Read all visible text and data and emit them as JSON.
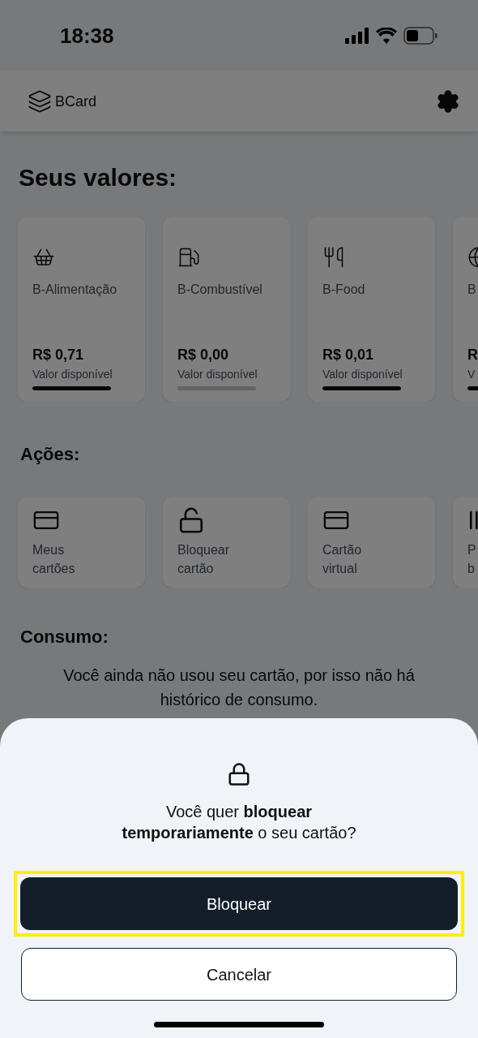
{
  "status_bar": {
    "time": "18:38"
  },
  "header": {
    "logo": "BCard"
  },
  "balances": {
    "title": "Seus valores:",
    "cards": [
      {
        "name": "B-Alimentação",
        "amount": "R$ 0,71",
        "caption": "Valor disponível",
        "level": 1
      },
      {
        "name": "B-Combustível",
        "amount": "R$ 0,00",
        "caption": "Valor disponível",
        "level": 0
      },
      {
        "name": "B-Food",
        "amount": "R$ 0,01",
        "caption": "Valor disponível",
        "level": 1
      },
      {
        "name": "B",
        "amount": "R",
        "caption": "V",
        "level": 1
      }
    ]
  },
  "actions": {
    "title": "Ações:",
    "items": [
      {
        "label": "Meus cartões",
        "kind": "cards"
      },
      {
        "label": "Bloquear cartão",
        "kind": "lock"
      },
      {
        "label": "Cartão virtual",
        "kind": "cards"
      },
      {
        "label": "P b",
        "kind": "barcode"
      }
    ]
  },
  "consumption": {
    "title": "Consumo:",
    "message": "Você ainda não usou seu cartão, por isso não há histórico de consumo."
  },
  "sheet": {
    "question": "Você quer **bloquear temporariamente** o seu cartão?",
    "confirm": {
      "label": "Bloquear",
      "highlighted": true
    },
    "cancel": {
      "label": "Cancelar"
    }
  }
}
